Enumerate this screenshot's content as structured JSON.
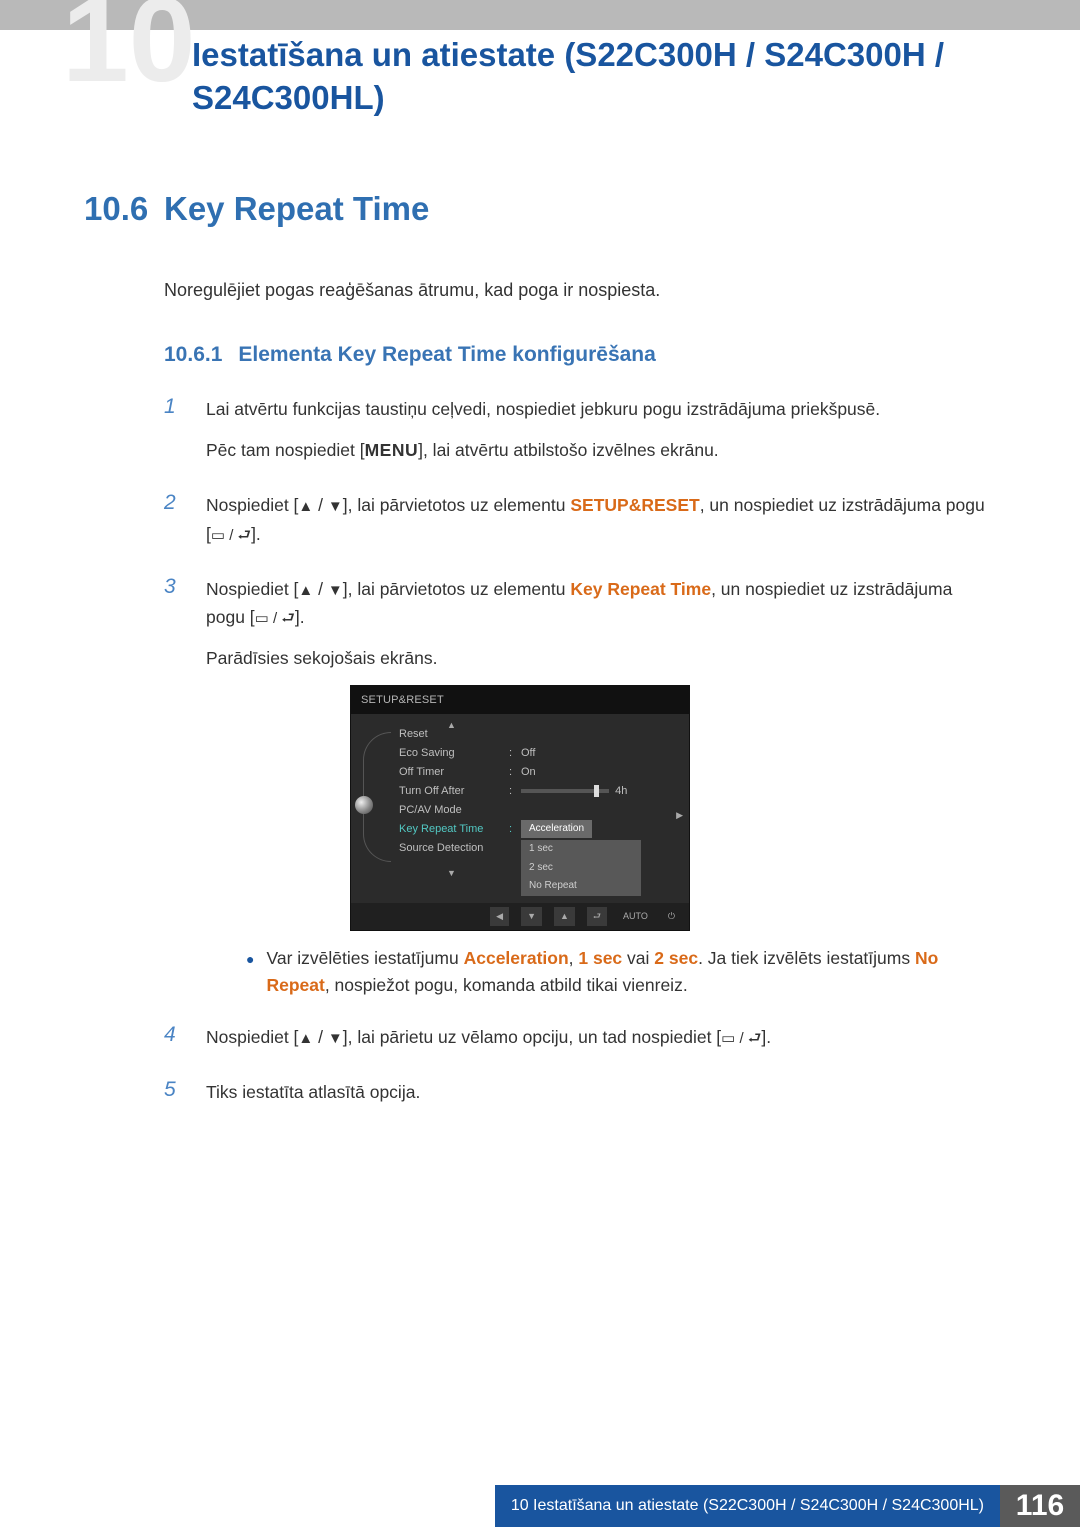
{
  "chapter_title": "Iestatīšana un atiestate (S22C300H / S24C300H / S24C300HL)",
  "section_num": "10.6",
  "section_title": "Key Repeat Time",
  "intro_text": "Noregulējiet pogas reaģēšanas ātrumu, kad poga ir nospiesta.",
  "subsection_num": "10.6.1",
  "subsection_title": "Elementa Key Repeat Time konfigurēšana",
  "steps": {
    "s1": {
      "num": "1",
      "line1": "Lai atvērtu funkcijas taustiņu ceļvedi, nospiediet jebkuru pogu izstrādājuma priekšpusē.",
      "line2a": "Pēc tam nospiediet [",
      "menu": "MENU",
      "line2b": "], lai atvērtu atbilstošo izvēlnes ekrānu."
    },
    "s2": {
      "num": "2",
      "pre": "Nospiediet [",
      "mid": "], lai pārvietotos uz elementu ",
      "accent": "SETUP&RESET",
      "after": ", un nospiediet uz izstrādājuma pogu [",
      "tail": "]."
    },
    "s3": {
      "num": "3",
      "pre": "Nospiediet [",
      "mid": "], lai pārvietotos uz elementu ",
      "accent": "Key Repeat Time",
      "after": ", un nospiediet uz izstrādājuma pogu [",
      "tail": "].",
      "postline": "Parādīsies sekojošais ekrāns."
    },
    "bullet": {
      "pre": "Var izvēlēties iestatījumu ",
      "a1": "Acceleration",
      "comma1": ", ",
      "a2": "1 sec",
      "or": " vai ",
      "a3": "2 sec",
      "post1": ". Ja tiek izvēlēts iestatījums ",
      "a4": "No Repeat",
      "post2": ", nospiežot pogu, komanda atbild tikai vienreiz."
    },
    "s4": {
      "num": "4",
      "pre": "Nospiediet [",
      "mid": "], lai pārietu uz vēlamo opciju, un tad nospiediet [",
      "tail": "]."
    },
    "s5": {
      "num": "5",
      "text": "Tiks iestatīta atlasītā opcija."
    }
  },
  "osd": {
    "title": "SETUP&RESET",
    "rows": {
      "reset": "Reset",
      "eco": "Eco Saving",
      "eco_val": "Off",
      "off_timer": "Off Timer",
      "off_timer_val": "On",
      "turn_off": "Turn Off After",
      "turn_off_val": "4h",
      "pcav": "PC/AV Mode",
      "krt": "Key Repeat Time",
      "krt_sel": "Acceleration",
      "src": "Source Detection",
      "opt1": "1 sec",
      "opt2": "2 sec",
      "opt3": "No Repeat"
    },
    "btns": {
      "auto": "AUTO"
    }
  },
  "footer_text": "10 Iestatīšana un atiestate (S22C300H / S24C300H / S24C300HL)",
  "footer_page": "116",
  "chart_data": null
}
